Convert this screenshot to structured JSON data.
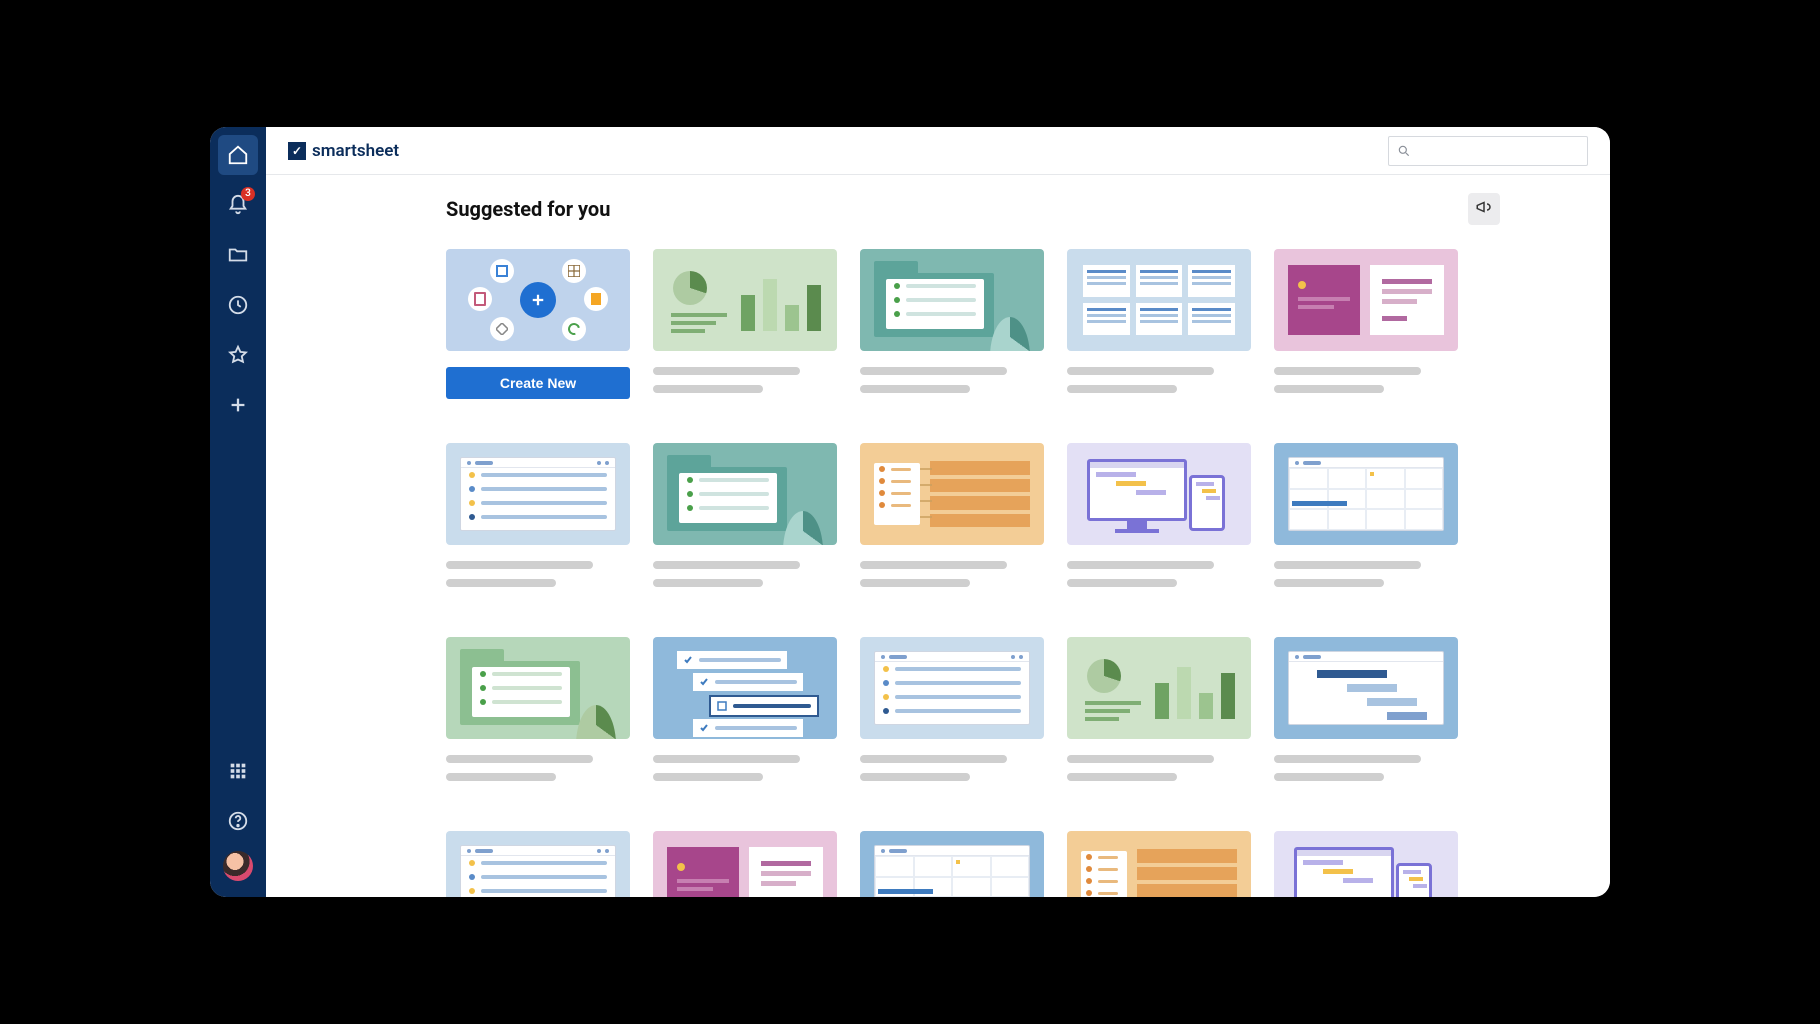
{
  "brand": {
    "name": "smartsheet"
  },
  "sidebar": {
    "notification_count": "3"
  },
  "header": {
    "section_title": "Suggested for you"
  },
  "actions": {
    "create_new_label": "Create New"
  },
  "colors": {
    "sidebar_bg": "#0b2d5b",
    "primary_button": "#1f6fd1"
  },
  "template_grid": {
    "rows": 4,
    "cols": 5
  }
}
